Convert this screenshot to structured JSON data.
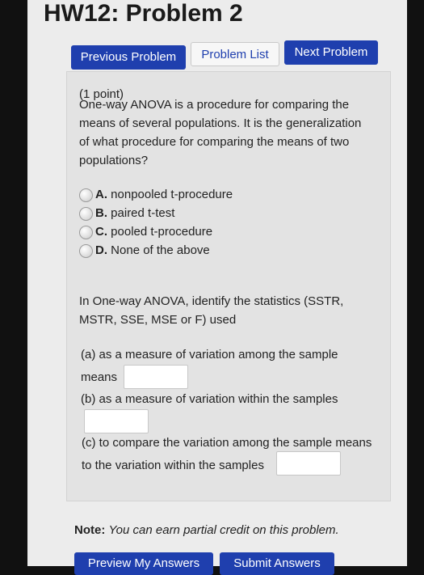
{
  "page": {
    "title": "HW12: Problem 2"
  },
  "nav": {
    "previous": "Previous Problem",
    "list": "Problem List",
    "next": "Next Problem"
  },
  "problem": {
    "points": "(1 point)",
    "question_lines": [
      "One-way ANOVA is a procedure for comparing the",
      "means of several populations. It is the generalization",
      "of what procedure for comparing the means of two",
      "populations?"
    ],
    "options": [
      {
        "letter": "A.",
        "text": "nonpooled t-procedure"
      },
      {
        "letter": "B.",
        "text": "paired t-test"
      },
      {
        "letter": "C.",
        "text": "pooled t-procedure"
      },
      {
        "letter": "D.",
        "text": "None of the above"
      }
    ],
    "part2_lines": [
      "In One-way ANOVA, identify the statistics (SSTR,",
      "MSTR, SSE, MSE or F) used"
    ],
    "a_line1": "(a) as a measure of variation among the sample",
    "a_line2": "means",
    "a_answer": "",
    "b_line": "(b) as a measure of variation within the samples",
    "b_answer": "",
    "c_line1": "(c) to compare the variation among the sample means",
    "c_line2": "to the variation within the samples",
    "c_answer": ""
  },
  "note": {
    "label": "Note:",
    "text": "You can earn partial credit on this problem."
  },
  "actions": {
    "preview": "Preview My Answers",
    "submit": "Submit Answers"
  }
}
